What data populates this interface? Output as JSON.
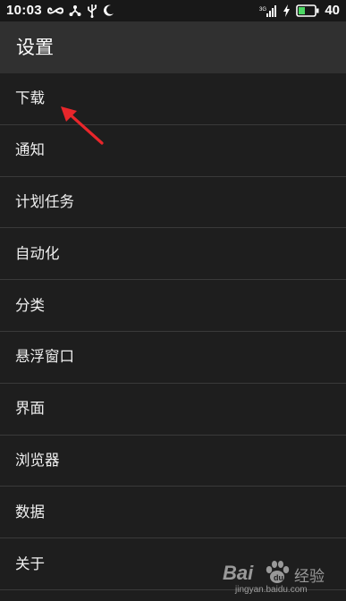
{
  "status_bar": {
    "time": "10:03",
    "battery_level": "40",
    "left_icons": [
      "infinity-icon",
      "share-icon",
      "usb-icon",
      "moon-icon"
    ],
    "right_icons": [
      "signal-icon",
      "charging-icon",
      "battery-icon"
    ],
    "battery_color": "#4cd964"
  },
  "header": {
    "title": "设置"
  },
  "menu": {
    "items": [
      {
        "label": "下载"
      },
      {
        "label": "通知"
      },
      {
        "label": "计划任务"
      },
      {
        "label": "自动化"
      },
      {
        "label": "分类"
      },
      {
        "label": "悬浮窗口"
      },
      {
        "label": "界面"
      },
      {
        "label": "浏览器"
      },
      {
        "label": "数据"
      },
      {
        "label": "关于"
      }
    ]
  },
  "annotation": {
    "arrow_color": "#e8262b",
    "target_item": "下载"
  },
  "watermark": {
    "brand": "Bai",
    "suffix": "经验",
    "url": "jingyan.baidu.com"
  },
  "colors": {
    "background": "#1e1e1e",
    "header": "#303030",
    "divider": "#3a3a3a",
    "text": "#f0f0f0"
  }
}
